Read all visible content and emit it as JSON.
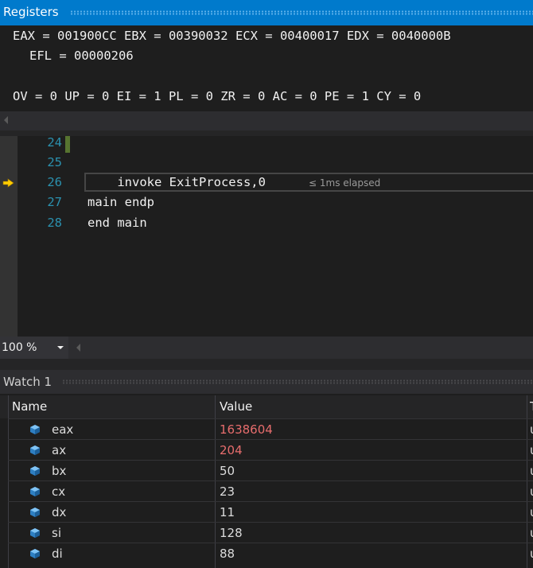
{
  "registers": {
    "title": "Registers",
    "line1": "EAX = 001900CC EBX = 00390032 ECX = 00400017 EDX = 0040000B",
    "line2": "EFL = 00000206",
    "line3": "OV = 0 UP = 0 EI = 1 PL = 0 ZR = 0 AC = 0 PE = 1 CY = 0"
  },
  "editor": {
    "lines": [
      {
        "num": "24",
        "code": ""
      },
      {
        "num": "25",
        "code": ""
      },
      {
        "num": "26",
        "code": "    invoke ExitProcess,0"
      },
      {
        "num": "27",
        "code": "main endp"
      },
      {
        "num": "28",
        "code": "end main"
      }
    ],
    "elapsed": "≤ 1ms elapsed",
    "current_line_icon": "yellow-arrow-icon",
    "colors": {
      "line_number": "#2b91af",
      "current_line_arrow": "#ffcc00"
    }
  },
  "zoom": {
    "value": "100 %"
  },
  "watch": {
    "title": "Watch 1",
    "columns": {
      "name": "Name",
      "value": "Value",
      "type": "T"
    },
    "rows": [
      {
        "name": "eax",
        "value": "1638604",
        "changed": true,
        "type": "u"
      },
      {
        "name": "ax",
        "value": "204",
        "changed": true,
        "type": "u"
      },
      {
        "name": "bx",
        "value": "50",
        "changed": false,
        "type": "u"
      },
      {
        "name": "cx",
        "value": "23",
        "changed": false,
        "type": "u"
      },
      {
        "name": "dx",
        "value": "11",
        "changed": false,
        "type": "u"
      },
      {
        "name": "si",
        "value": "128",
        "changed": false,
        "type": "u"
      },
      {
        "name": "di",
        "value": "88",
        "changed": false,
        "type": "u"
      }
    ],
    "colors": {
      "changed_value": "#e76d6d"
    },
    "row_icon": "variable-cube-icon"
  }
}
